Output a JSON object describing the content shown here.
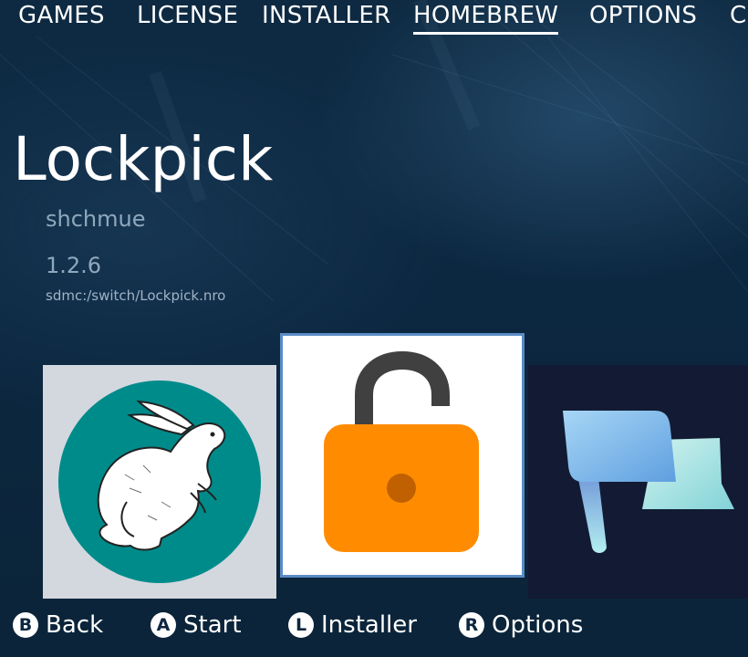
{
  "tabs": [
    {
      "label": "GAMES",
      "active": false
    },
    {
      "label": "LICENSE",
      "active": false
    },
    {
      "label": "INSTALLER",
      "active": false
    },
    {
      "label": "HOMEBREW",
      "active": true
    },
    {
      "label": "OPTIONS",
      "active": false
    },
    {
      "label": "C",
      "active": false
    }
  ],
  "app": {
    "title": "Lockpick",
    "author": "shchmue",
    "version": "1.2.6",
    "path": "sdmc:/switch/Lockpick.nro"
  },
  "tiles": [
    {
      "icon": "rabbit-icon",
      "selected": false
    },
    {
      "icon": "open-padlock-icon",
      "selected": true
    },
    {
      "icon": "flag-icon",
      "selected": false
    }
  ],
  "controls": [
    {
      "button": "B",
      "label": "Back"
    },
    {
      "button": "A",
      "label": "Start"
    },
    {
      "button": "L",
      "label": "Installer"
    },
    {
      "button": "R",
      "label": "Options"
    }
  ],
  "colors": {
    "background": "#0c2740",
    "selection_border": "#5b8cc6",
    "lock_orange": "#ff8c00",
    "rabbit_circle": "#008b8b"
  }
}
